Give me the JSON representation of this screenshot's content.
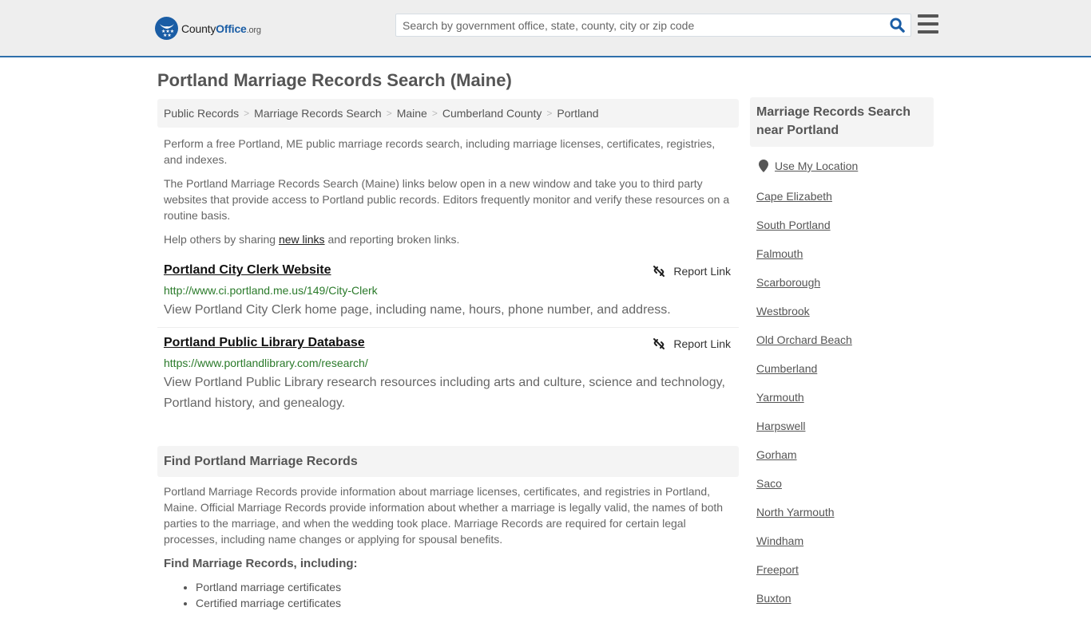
{
  "header": {
    "logo": {
      "name_part1": "County",
      "name_part2": "Office",
      "suffix": ".org"
    },
    "search": {
      "placeholder": "Search by government office, state, county, city or zip code",
      "value": ""
    },
    "icons": {
      "search": "search-icon",
      "menu": "hamburger-menu-icon",
      "logo": "eagle-stars-icon"
    },
    "colors": {
      "brand": "#1a5da5",
      "header_bg": "#eeeeee",
      "header_border": "#2f6fab"
    }
  },
  "page": {
    "title": "Portland Marriage Records Search (Maine)",
    "breadcrumb": [
      "Public Records",
      "Marriage Records Search",
      "Maine",
      "Cumberland County",
      "Portland"
    ],
    "intro": {
      "p1": "Perform a free Portland, ME public marriage records search, including marriage licenses, certificates, registries, and indexes.",
      "p2": "The Portland Marriage Records Search (Maine) links below open in a new window and take you to third party websites that provide access to Portland public records. Editors frequently monitor and verify these resources on a routine basis.",
      "p3_before": "Help others by sharing ",
      "p3_link": "new links",
      "p3_after": " and reporting broken links."
    },
    "resources": [
      {
        "title": "Portland City Clerk Website",
        "url": "http://www.ci.portland.me.us/149/City-Clerk",
        "description": "View Portland City Clerk home page, including name, hours, phone number, and address.",
        "report_label": "Report Link"
      },
      {
        "title": "Portland Public Library Database",
        "url": "https://www.portlandlibrary.com/research/",
        "description": "View Portland Public Library research resources including arts and culture, science and technology, Portland history, and genealogy.",
        "report_label": "Report Link"
      }
    ],
    "find_section": {
      "heading": "Find Portland Marriage Records",
      "body": "Portland Marriage Records provide information about marriage licenses, certificates, and registries in Portland, Maine. Official Marriage Records provide information about whether a marriage is legally valid, the names of both parties to the marriage, and when the wedding took place. Marriage Records are required for certain legal processes, including name changes or applying for spousal benefits.",
      "subheading": "Find Marriage Records, including:",
      "bullets": [
        "Portland marriage certificates",
        "Certified marriage certificates"
      ]
    },
    "colors": {
      "url_green": "#2a7a2a",
      "text": "#555555"
    }
  },
  "sidebar": {
    "heading": "Marriage Records Search near Portland",
    "use_location": "Use My Location",
    "nearby": [
      "Cape Elizabeth",
      "South Portland",
      "Falmouth",
      "Scarborough",
      "Westbrook",
      "Old Orchard Beach",
      "Cumberland",
      "Yarmouth",
      "Harpswell",
      "Gorham",
      "Saco",
      "North Yarmouth",
      "Windham",
      "Freeport",
      "Buxton"
    ]
  }
}
